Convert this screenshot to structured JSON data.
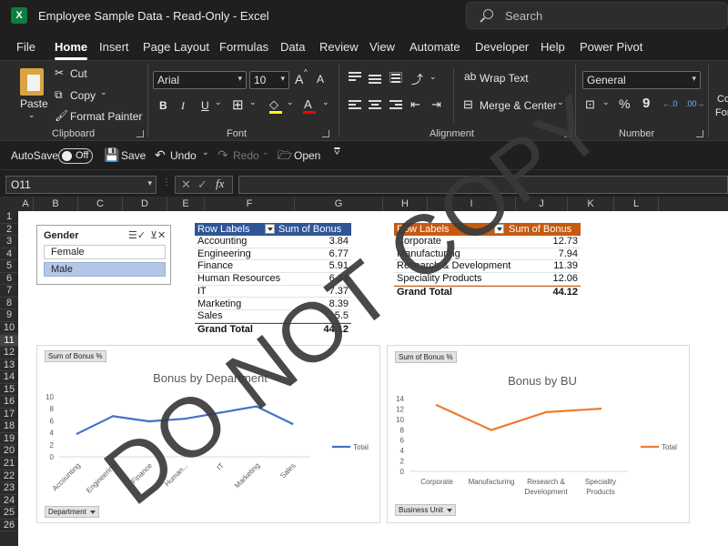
{
  "window": {
    "title": "Employee Sample Data  -  Read-Only  -  Excel",
    "search_placeholder": "Search"
  },
  "tabs": [
    "File",
    "Home",
    "Insert",
    "Page Layout",
    "Formulas",
    "Data",
    "Review",
    "View",
    "Automate",
    "Developer",
    "Help",
    "Power Pivot"
  ],
  "ribbon": {
    "paste": "Paste",
    "cut": "Cut",
    "copy": "Copy",
    "format_painter": "Format Painter",
    "clipboard_label": "Clipboard",
    "font_name": "Arial",
    "font_size": "10",
    "font_label": "Font",
    "wrap_text": "Wrap Text",
    "merge_center": "Merge & Center",
    "alignment_label": "Alignment",
    "number_format": "General",
    "number_label": "Number",
    "increase_font": "A",
    "decrease_font": "A",
    "bold": "B",
    "italic": "I",
    "underline": "U",
    "font_color": "A",
    "percent": "%",
    "comma": "9",
    "cond_partial_1": "Co",
    "cond_partial_2": "For",
    "colors": {
      "fill_yellow": "#ffff00",
      "font_red": "#ff0000"
    }
  },
  "qat": {
    "autosave": "AutoSave",
    "toggle": "Off",
    "save": "Save",
    "undo": "Undo",
    "redo": "Redo",
    "open": "Open"
  },
  "formula_bar": {
    "name_box": "O11",
    "fx": "fx"
  },
  "columns": [
    "A",
    "B",
    "C",
    "D",
    "E",
    "F",
    "G",
    "H",
    "I",
    "J",
    "K",
    "L"
  ],
  "rows": [
    "1",
    "2",
    "3",
    "4",
    "5",
    "6",
    "7",
    "8",
    "9",
    "10",
    "11",
    "12",
    "13",
    "14",
    "15",
    "16",
    "17",
    "18",
    "19",
    "20",
    "21",
    "22",
    "23",
    "24",
    "25",
    "26"
  ],
  "selected_row": "11",
  "slicer": {
    "title": "Gender",
    "items": [
      {
        "label": "Female",
        "selected": false
      },
      {
        "label": "Male",
        "selected": true
      }
    ]
  },
  "pivot_department": {
    "header_label": "Row Labels",
    "header_value": "Sum of Bonus %",
    "header_color": "#2f5597",
    "rows": [
      {
        "label": "Accounting",
        "value": "3.84"
      },
      {
        "label": "Engineering",
        "value": "6.77"
      },
      {
        "label": "Finance",
        "value": "5.91"
      },
      {
        "label": "Human Resources",
        "value": "6.34"
      },
      {
        "label": "IT",
        "value": "7.37"
      },
      {
        "label": "Marketing",
        "value": "8.39"
      },
      {
        "label": "Sales",
        "value": "5.5"
      }
    ],
    "total_label": "Grand Total",
    "total_value": "44.12"
  },
  "pivot_bu": {
    "header_label": "Row Labels",
    "header_value": "Sum of Bonus %",
    "header_color": "#c55a11",
    "rows": [
      {
        "label": "Corporate",
        "value": "12.73"
      },
      {
        "label": "Manufacturing",
        "value": "7.94"
      },
      {
        "label": "Research & Development",
        "value": "11.39"
      },
      {
        "label": "Speciality Products",
        "value": "12.06"
      }
    ],
    "total_label": "Grand Total",
    "total_value": "44.12"
  },
  "chart_data": [
    {
      "type": "line",
      "title": "Bonus by Department",
      "field_button": "Sum of Bonus %",
      "axis_button": "Department",
      "categories": [
        "Accounting",
        "Engineering",
        "Finance",
        "Human...",
        "IT",
        "Marketing",
        "Sales"
      ],
      "series": [
        {
          "name": "Total",
          "values": [
            3.84,
            6.77,
            5.91,
            6.34,
            7.37,
            8.39,
            5.5
          ],
          "color": "#4472c4"
        }
      ],
      "y_ticks": [
        "0",
        "2",
        "4",
        "6",
        "8",
        "10"
      ],
      "ylim": [
        0,
        10
      ],
      "legend": "right",
      "grid": false
    },
    {
      "type": "line",
      "title": "Bonus by BU",
      "field_button": "Sum of Bonus %",
      "axis_button": "Business Unit",
      "categories": [
        "Corporate",
        "Manufacturing",
        "Research & Development",
        "Speciality Products"
      ],
      "series": [
        {
          "name": "Total",
          "values": [
            12.73,
            7.94,
            11.39,
            12.06
          ],
          "color": "#ed7d31"
        }
      ],
      "y_ticks": [
        "0",
        "2",
        "4",
        "6",
        "8",
        "10",
        "12",
        "14"
      ],
      "ylim": [
        0,
        14
      ],
      "legend": "right",
      "grid": false
    }
  ],
  "watermark": "DO NOT COPY"
}
